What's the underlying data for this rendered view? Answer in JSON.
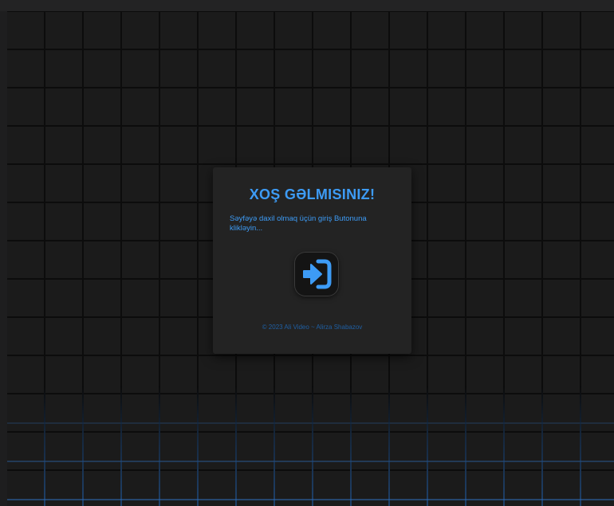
{
  "welcome": {
    "title": "XOŞ GƏLMISINIZ!",
    "message": "Səyfəyə daxil olmaq üçün giriş Butonuna klikləyin...",
    "button_icon": "sign-in-icon",
    "footer": "© 2023 Ali Video ~ Alirza Shabazov"
  },
  "colors": {
    "accent": "#3d9bf5",
    "footer": "#1f5fa3",
    "card_bg": "#232323",
    "grid_bg": "#1b1b1b"
  }
}
